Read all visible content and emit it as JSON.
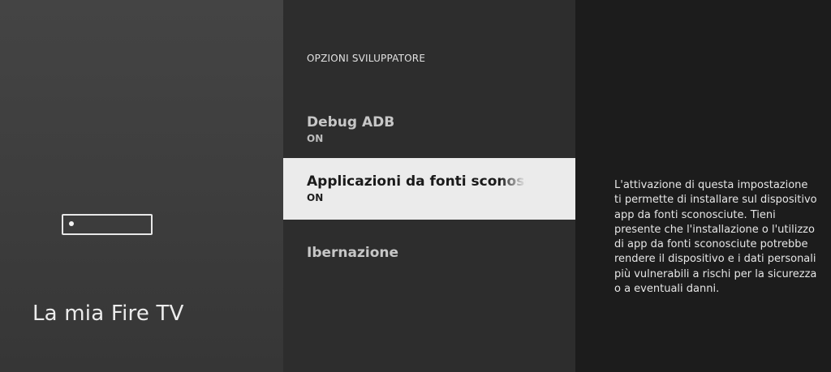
{
  "left_panel": {
    "icon": "fire-tv-stick-icon",
    "title": "La mia Fire TV"
  },
  "middle_panel": {
    "section_title": "OPZIONI SVILUPPATORE",
    "items": [
      {
        "label": "Debug ADB",
        "value": "ON",
        "selected": false
      },
      {
        "label": "Applicazioni da fonti sconosciute",
        "value": "ON",
        "selected": true
      },
      {
        "label": "Ibernazione",
        "value": "",
        "selected": false
      }
    ]
  },
  "right_panel": {
    "description": "L'attivazione di questa impostazione ti permette di installare sul dispositivo app da fonti sconosciute. Tieni presente che l'installazione o l'utilizzo di app da fonti sconosciute potrebbe rendere il dispositivo e i dati personali più vulnerabili a rischi per la sicurezza o a eventuali danni."
  },
  "colors": {
    "selected_background": "#ebebeb",
    "panel_background": "#2d2d2d",
    "description_background": "#1c1c1c"
  }
}
